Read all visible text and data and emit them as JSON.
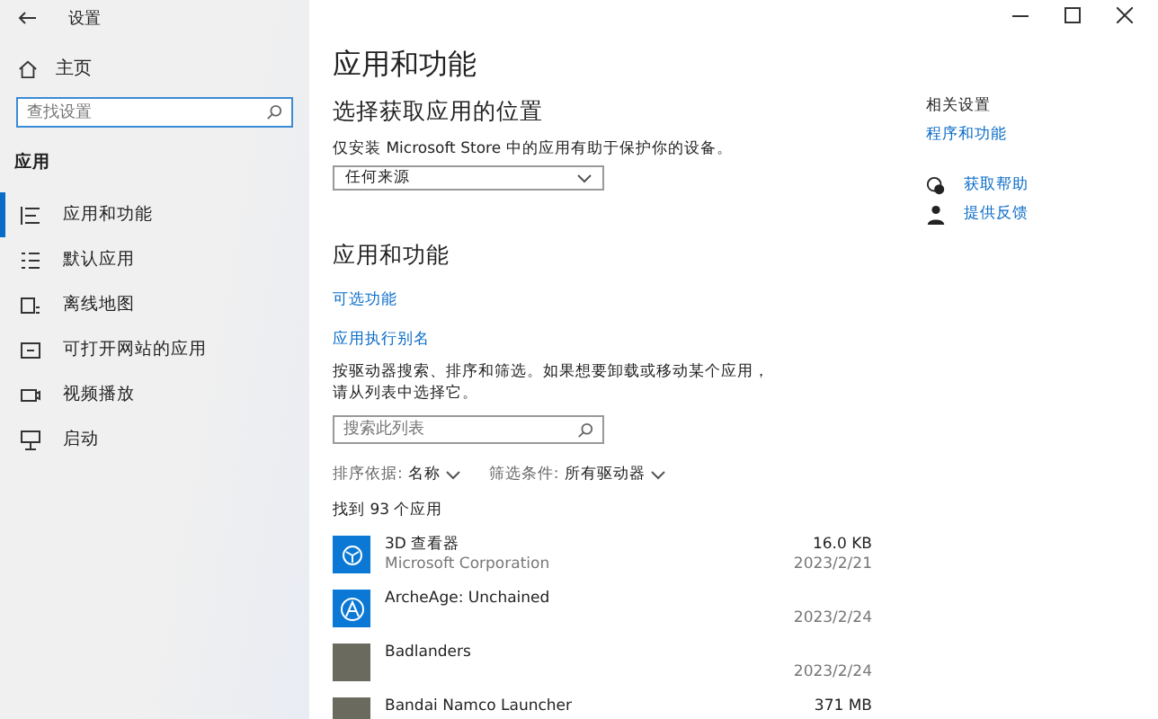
{
  "window": {
    "title": "设置"
  },
  "sidebar": {
    "home": "主页",
    "search": {
      "placeholder": "查找设置"
    },
    "section": "应用",
    "items": [
      {
        "label": "应用和功能",
        "kind": "list",
        "selected": true
      },
      {
        "label": "默认应用",
        "kind": "default",
        "selected": false
      },
      {
        "label": "离线地图",
        "kind": "map",
        "selected": false
      },
      {
        "label": "可打开网站的应用",
        "kind": "web",
        "selected": false
      },
      {
        "label": "视频播放",
        "kind": "video",
        "selected": false
      },
      {
        "label": "启动",
        "kind": "startup",
        "selected": false
      }
    ]
  },
  "main": {
    "title": "应用和功能",
    "location": {
      "heading": "选择获取应用的位置",
      "description": "仅安装 Microsoft Store 中的应用有助于保护你的设备。",
      "dropdown": "任何来源"
    },
    "apps": {
      "heading": "应用和功能",
      "links": [
        "可选功能",
        "应用执行别名"
      ],
      "description": "按驱动器搜索、排序和筛选。如果想要卸载或移动某个应用，请从列表中选择它。",
      "search": {
        "placeholder": "搜索此列表"
      },
      "sort": {
        "label": "排序依据:",
        "value": "名称"
      },
      "filter": {
        "label": "筛选条件:",
        "value": "所有驱动器"
      },
      "count": "找到 93 个应用",
      "rows": [
        {
          "name": "3D 查看器",
          "publisher": "Microsoft Corporation",
          "size": "16.0 KB",
          "date": "2023/2/21",
          "kind": "cube"
        },
        {
          "name": "ArcheAge: Unchained",
          "date": "2023/2/24",
          "kind": "letter"
        },
        {
          "name": "Badlanders",
          "date": "2023/2/24",
          "kind": "photo"
        },
        {
          "name": "Bandai Namco Launcher",
          "size": "371 MB",
          "kind": "photo"
        }
      ]
    }
  },
  "related": {
    "heading": "相关设置",
    "link": "程序和功能",
    "help": [
      {
        "label": "获取帮助",
        "kind": "help"
      },
      {
        "label": "提供反馈",
        "kind": "feedback"
      }
    ]
  }
}
